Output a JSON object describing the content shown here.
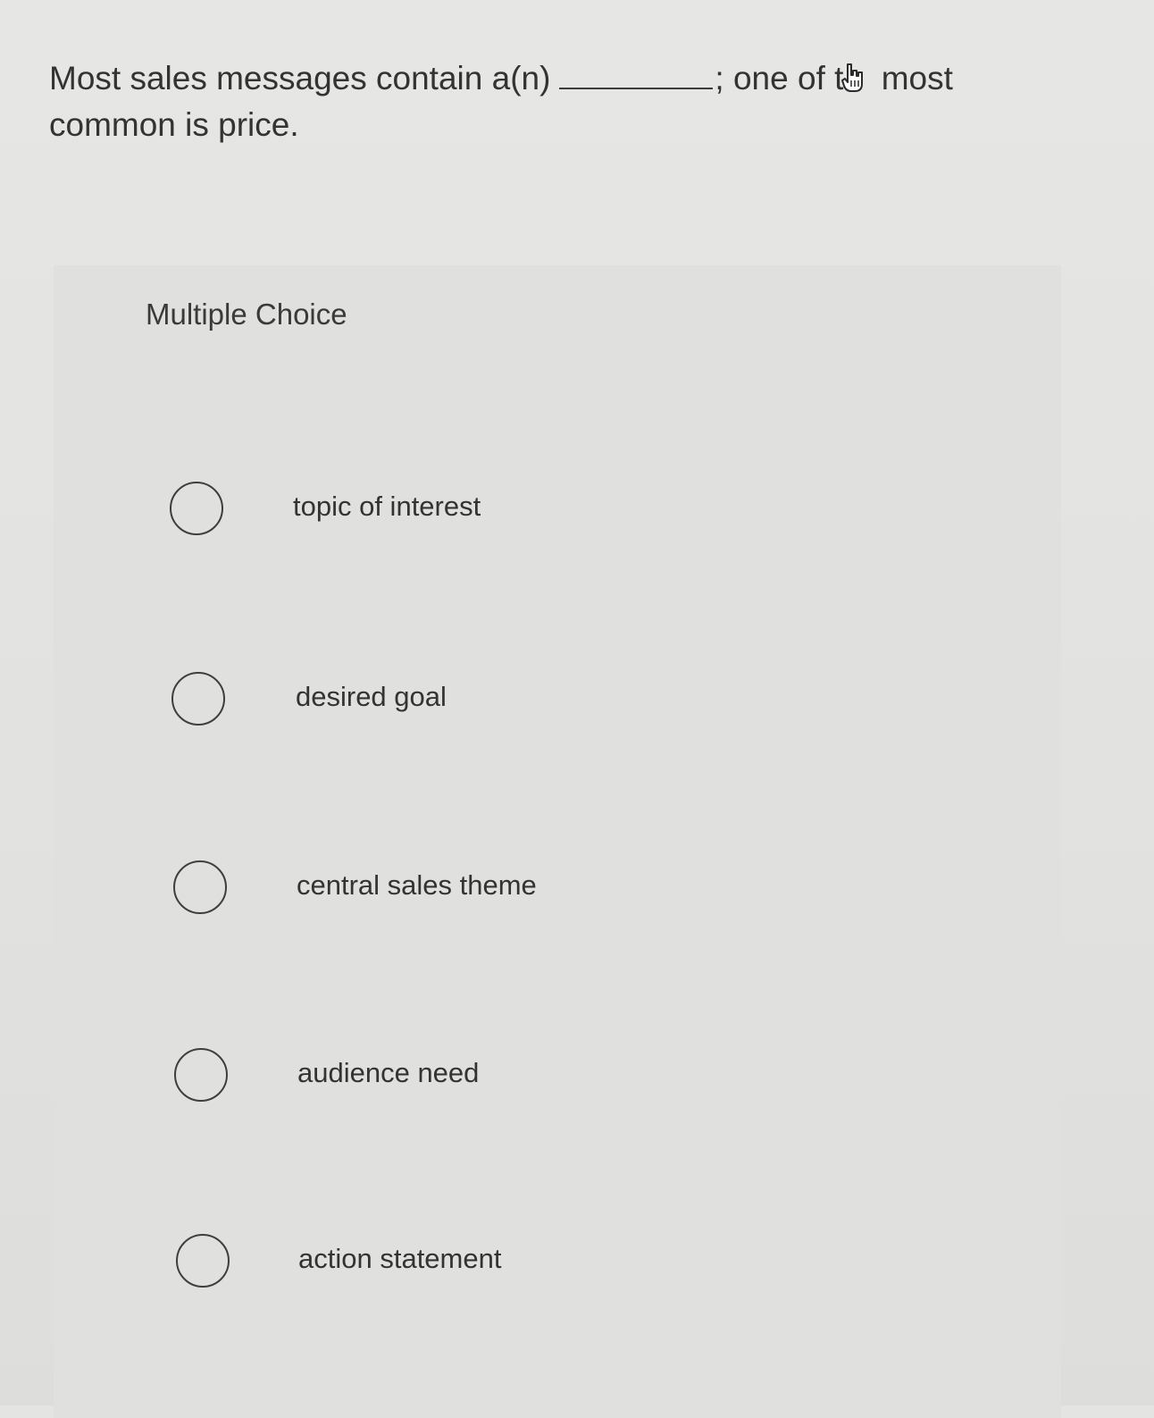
{
  "question": {
    "text_before": "Most sales messages contain a(n)",
    "text_after_part1": "; one of t",
    "text_after_part2": " most",
    "text_line2": "common is price."
  },
  "panel": {
    "title": "Multiple Choice"
  },
  "options": [
    {
      "label": "topic of interest"
    },
    {
      "label": "desired goal"
    },
    {
      "label": "central sales theme"
    },
    {
      "label": "audience need"
    },
    {
      "label": "action statement"
    }
  ],
  "icons": {
    "cursor": "hand-pointer-icon",
    "radio": "radio-empty-icon"
  },
  "colors": {
    "background": "#e4e4e2",
    "text": "#333333",
    "radio_border": "#3e3e3e"
  }
}
